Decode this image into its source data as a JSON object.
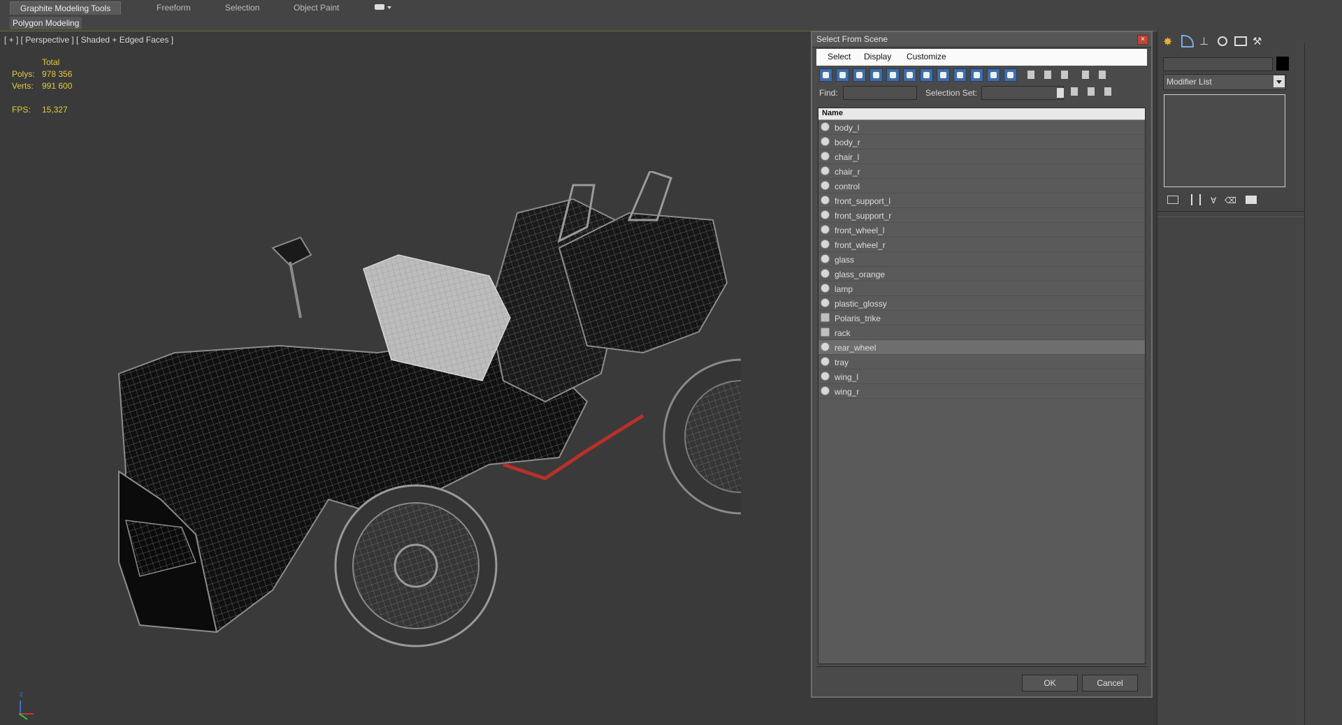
{
  "ribbon": {
    "tabs": [
      "Graphite Modeling Tools",
      "Freeform",
      "Selection",
      "Object Paint"
    ],
    "active_tab": "Graphite Modeling Tools",
    "sub_label": "Polygon Modeling"
  },
  "viewport": {
    "label": "[ + ] [ Perspective ] [ Shaded + Edged Faces ]",
    "stats": {
      "total_label": "Total",
      "polys_label": "Polys:",
      "polys_value": "978 356",
      "verts_label": "Verts:",
      "verts_value": "991 600",
      "fps_label": "FPS:",
      "fps_value": "15,327"
    },
    "axis_label": "z"
  },
  "dialog": {
    "title": "Select From Scene",
    "menu": [
      "Select",
      "Display",
      "Customize"
    ],
    "find_label": "Find:",
    "find_value": "",
    "selection_set_label": "Selection Set:",
    "selection_set_value": "",
    "list_header": "Name",
    "items": [
      {
        "name": "body_l",
        "type": "object",
        "selected": false
      },
      {
        "name": "body_r",
        "type": "object",
        "selected": false
      },
      {
        "name": "chair_l",
        "type": "object",
        "selected": false
      },
      {
        "name": "chair_r",
        "type": "object",
        "selected": false
      },
      {
        "name": "control",
        "type": "object",
        "selected": false
      },
      {
        "name": "front_support_l",
        "type": "object",
        "selected": false
      },
      {
        "name": "front_support_r",
        "type": "object",
        "selected": false
      },
      {
        "name": "front_wheel_l",
        "type": "object",
        "selected": false
      },
      {
        "name": "front_wheel_r",
        "type": "object",
        "selected": false
      },
      {
        "name": "glass",
        "type": "object",
        "selected": false
      },
      {
        "name": "glass_orange",
        "type": "object",
        "selected": false
      },
      {
        "name": "lamp",
        "type": "object",
        "selected": false
      },
      {
        "name": "plastic_glossy",
        "type": "object",
        "selected": false
      },
      {
        "name": "Polaris_trike",
        "type": "group",
        "selected": false
      },
      {
        "name": "rack",
        "type": "group",
        "selected": false
      },
      {
        "name": "rear_wheel",
        "type": "object",
        "selected": true
      },
      {
        "name": "tray",
        "type": "object",
        "selected": false
      },
      {
        "name": "wing_l",
        "type": "object",
        "selected": false
      },
      {
        "name": "wing_r",
        "type": "object",
        "selected": false
      }
    ],
    "ok_label": "OK",
    "cancel_label": "Cancel"
  },
  "command_panel": {
    "modifier_list_label": "Modifier List",
    "icons": [
      "create-icon",
      "modify-icon",
      "hierarchy-icon",
      "motion-icon",
      "display-icon",
      "utilities-icon"
    ]
  },
  "colors": {
    "stats_yellow": "#e0cd40",
    "selection_blue": "#3e6ea8",
    "close_red": "#c0463b",
    "highlight_red": "#b8302a"
  }
}
